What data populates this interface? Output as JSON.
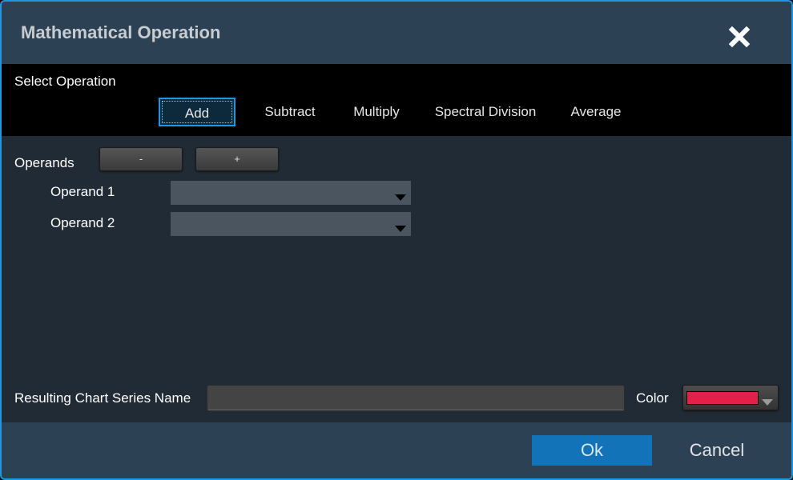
{
  "dialog": {
    "title": "Mathematical Operation",
    "close_icon": "close-icon"
  },
  "operation": {
    "label": "Select Operation",
    "selected": "Add",
    "options": [
      "Add",
      "Subtract",
      "Multiply",
      "Spectral Division",
      "Average"
    ]
  },
  "operands": {
    "label": "Operands",
    "remove_label": "-",
    "add_label": "+",
    "items": [
      {
        "label": "Operand 1",
        "value": ""
      },
      {
        "label": "Operand 2",
        "value": ""
      }
    ]
  },
  "result": {
    "series_name_label": "Resulting Chart Series Name",
    "series_name_value": "",
    "color_label": "Color",
    "color_value": "#e3204a"
  },
  "footer": {
    "ok_label": "Ok",
    "cancel_label": "Cancel",
    "ok_color": "#1273b8"
  },
  "theme": {
    "accent": "#1f96e0",
    "titlebar": "#2d4155",
    "body": "#212b36"
  }
}
